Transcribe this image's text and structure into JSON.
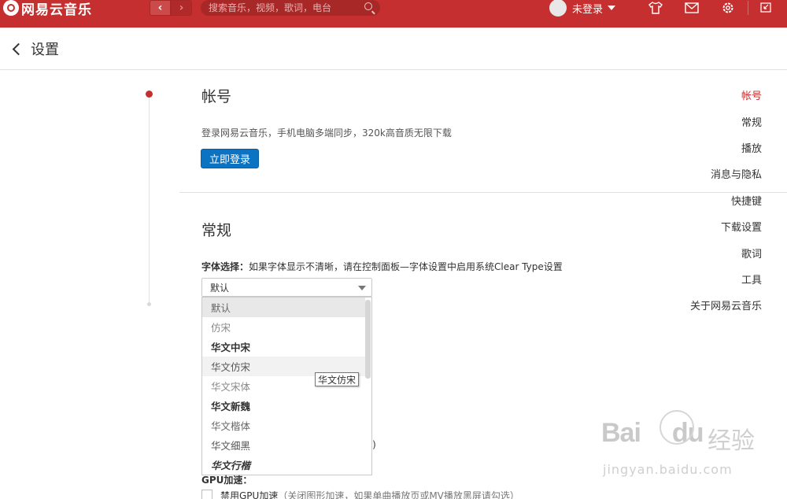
{
  "app": {
    "logo_text": "网易云音乐",
    "search_placeholder": "搜索音乐，视频，歌词，电台",
    "user_label": "未登录"
  },
  "header": {
    "title": "设置"
  },
  "sidebar": {
    "items": [
      {
        "label": "帐号",
        "active": true
      },
      {
        "label": "常规"
      },
      {
        "label": "播放"
      },
      {
        "label": "消息与隐私"
      },
      {
        "label": "快捷键"
      },
      {
        "label": "下载设置"
      },
      {
        "label": "歌词"
      },
      {
        "label": "工具"
      },
      {
        "label": "关于网易云音乐"
      }
    ]
  },
  "account": {
    "title": "帐号",
    "description": "登录网易云音乐，手机电脑多端同步，320k高音质无限下载",
    "login_button": "立即登录"
  },
  "general": {
    "title": "常规",
    "font_label": "字体选择：",
    "font_hint": "如果字体显示不清晰，请在控制面板—字体设置中启用系统Clear Type设置",
    "font_selected": "默认",
    "font_options": [
      "默认",
      "仿宋",
      "华文中宋",
      "华文仿宋",
      "华文宋体",
      "华文新魏",
      "华文楷体",
      "华文细黑",
      "华文行楷"
    ],
    "tooltip": "华文仿宋",
    "partial_text": ")",
    "gpu_title": "GPU加速：",
    "gpu_option": "禁用GPU加速",
    "gpu_hint": "（关闭图形加速，如果单曲播放页或MV播放黑屏请勾选）"
  },
  "watermark": {
    "logo": "Bai",
    "logo2": "du",
    "cn": "经验",
    "url": "jingyan.baidu.com"
  },
  "colors": {
    "brand_red": "#c62f2f",
    "login_blue": "#0c73c2"
  }
}
